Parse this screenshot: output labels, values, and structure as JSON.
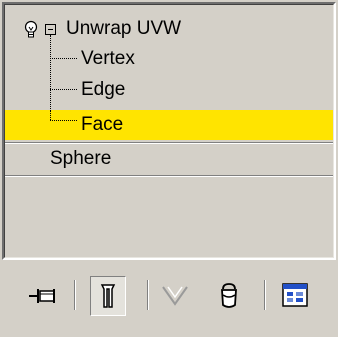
{
  "modifier_stack": {
    "items": [
      {
        "label": "Unwrap UVW",
        "type": "modifier",
        "expanded": true,
        "light_icon": "lightbulb-icon"
      },
      {
        "label": "Vertex",
        "type": "sub-object",
        "selected": false
      },
      {
        "label": "Edge",
        "type": "sub-object",
        "selected": false
      },
      {
        "label": "Face",
        "type": "sub-object",
        "selected": true
      },
      {
        "label": "Sphere",
        "type": "base-object"
      }
    ],
    "selection_color": "#ffe400"
  },
  "toolbar": {
    "buttons": [
      {
        "icon": "pin-stack-icon",
        "state": "normal"
      },
      {
        "icon": "show-end-result-icon",
        "state": "pressed"
      },
      {
        "icon": "make-unique-icon",
        "state": "disabled"
      },
      {
        "icon": "remove-modifier-icon",
        "state": "normal"
      },
      {
        "icon": "configure-modifier-sets-icon",
        "state": "normal"
      }
    ]
  }
}
